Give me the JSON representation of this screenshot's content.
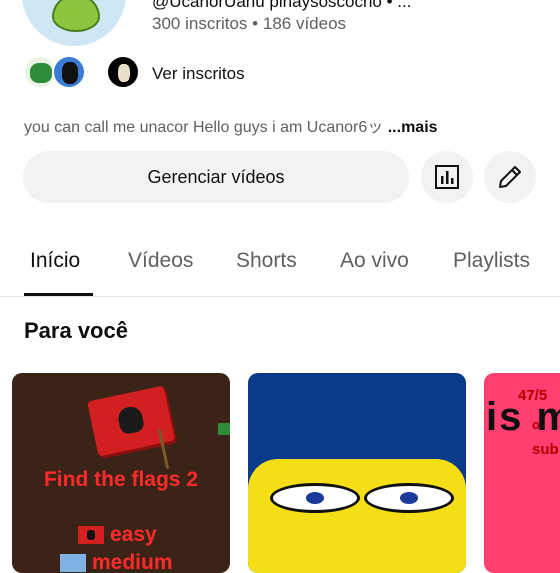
{
  "channel": {
    "handle_partial": "@UcanorUanu pinaysoscocho • ...",
    "subscribers": "300 inscritos",
    "videos": "186 vídeos",
    "stats_separator": "•",
    "see_subscribers": "Ver inscritos",
    "description": "you can call me unacor  Hello guys i am Ucanor6ッ",
    "more": "...mais"
  },
  "actions": {
    "manage_videos": "Gerenciar vídeos",
    "analytics_icon": "bar-chart-icon",
    "edit_icon": "pencil-icon"
  },
  "tabs": [
    {
      "label": "Início",
      "active": true
    },
    {
      "label": "Vídeos"
    },
    {
      "label": "Shorts"
    },
    {
      "label": "Ao vivo"
    },
    {
      "label": "Playlists"
    }
  ],
  "section": {
    "title": "Para você"
  },
  "cards": [
    {
      "title": "Find the flags 2",
      "line1": "easy",
      "line2": "medium"
    },
    {
      "description": "yellow cartoon face close-up"
    },
    {
      "big_text": "is m",
      "small1": "47/5",
      "small2": "o",
      "small3": "sub"
    }
  ],
  "colors": {
    "text_primary": "#0f0f0f",
    "text_secondary": "#606060",
    "button_bg": "#f2f2f2",
    "card1_bg": "#3b2417",
    "card2_bg": "#0a3a8a",
    "card3_bg": "#ff3f6f",
    "flag_red": "#d21f1f",
    "title_red": "#ff2a2a"
  }
}
